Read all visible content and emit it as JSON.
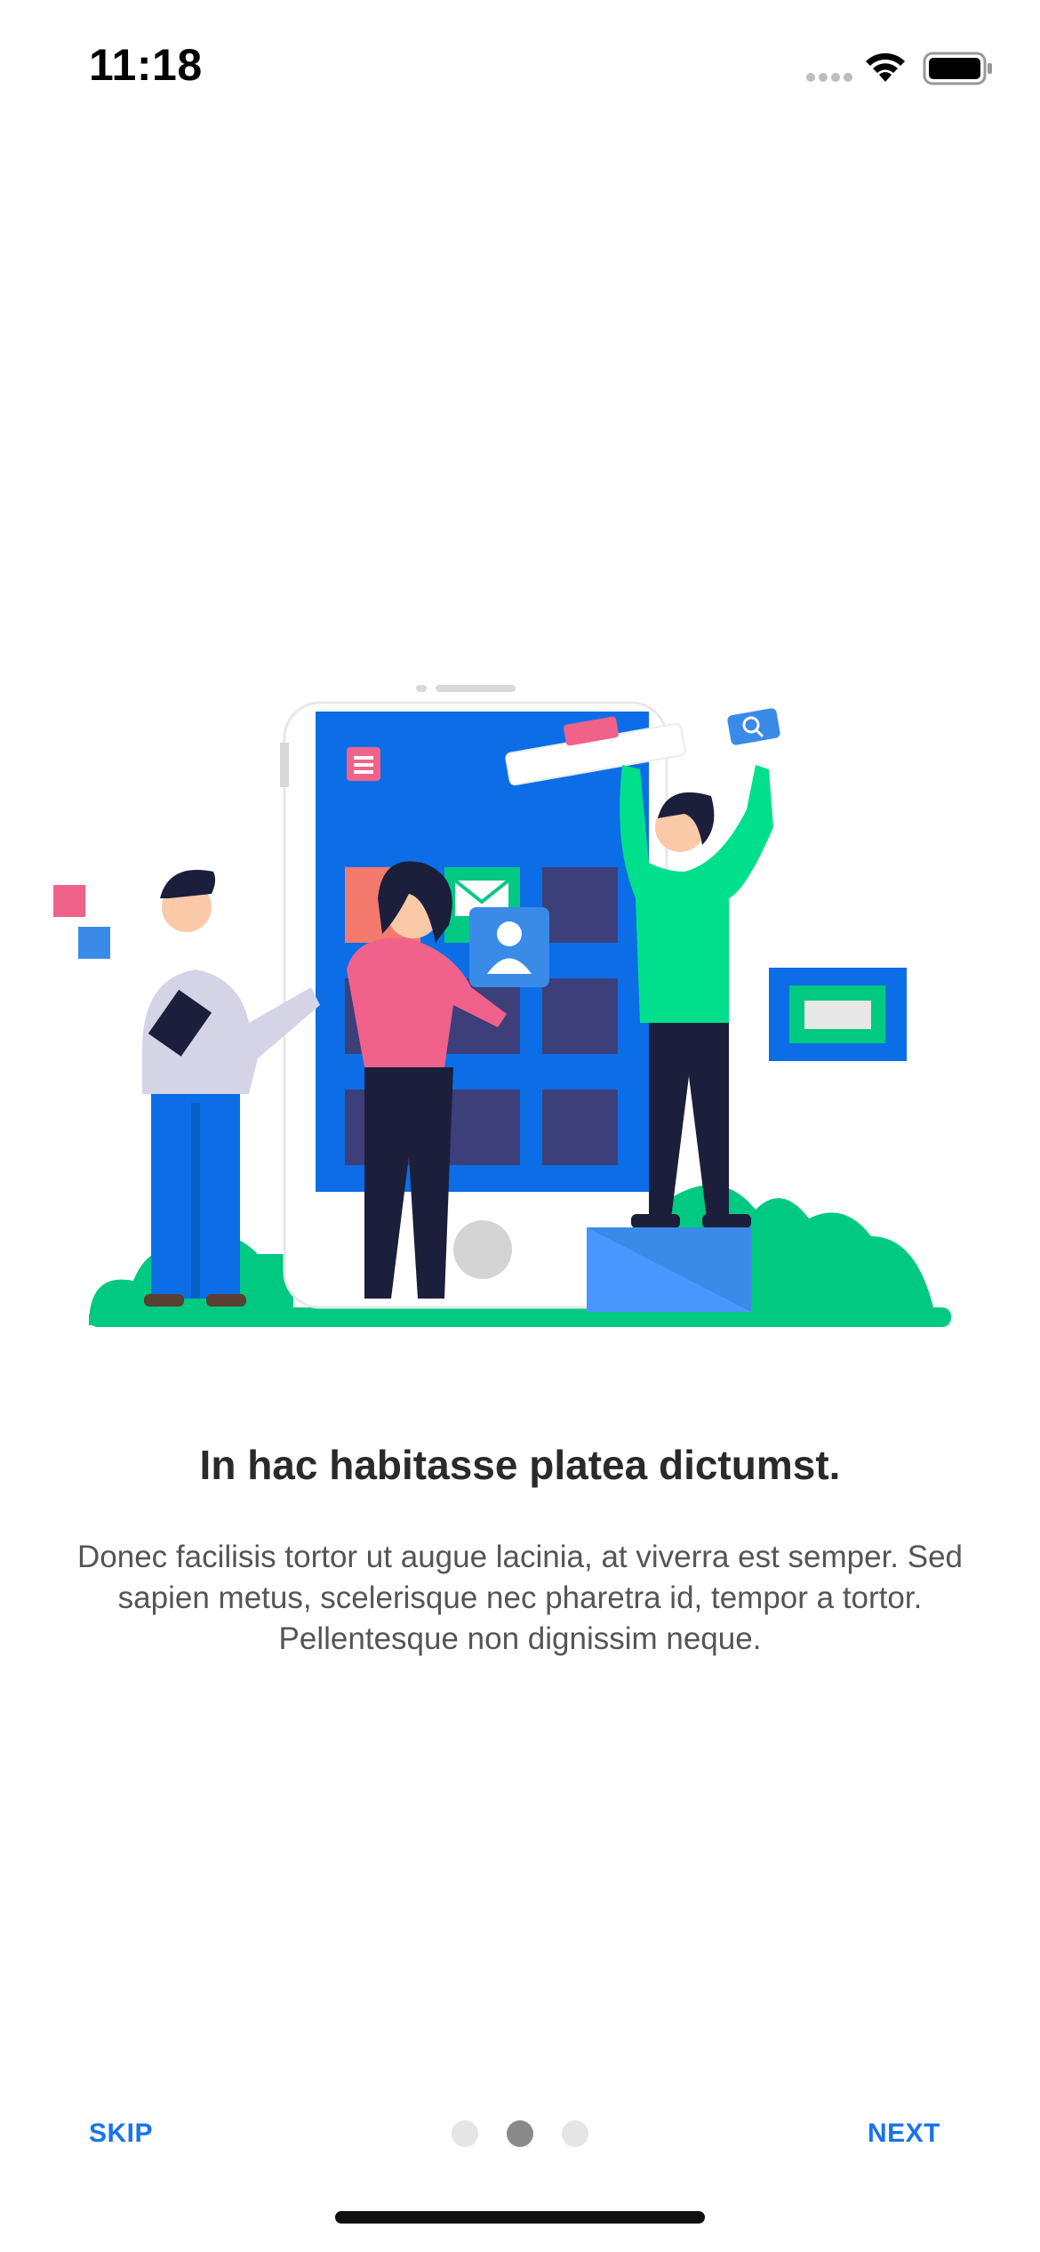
{
  "status_bar": {
    "time": "11:18",
    "icons": [
      "cellular-signal-icon",
      "wifi-icon",
      "battery-icon"
    ]
  },
  "illustration": {
    "name": "team-building-app-illustration"
  },
  "onboarding": {
    "title": "In hac habitasse platea dictumst.",
    "description": "Donec facilisis tortor ut augue lacinia, at viverra est semper. Sed sapien metus, scelerisque nec pharetra id, tempor a tortor. Pellentesque non dignissim neque."
  },
  "footer": {
    "skip_label": "SKIP",
    "next_label": "NEXT",
    "page_count": 3,
    "active_page": 2
  },
  "colors": {
    "accent": "#1a73e8",
    "phone_screen": "#0b6ee6",
    "green": "#00c982",
    "pink": "#f0628a",
    "navy": "#3d3f7a"
  }
}
